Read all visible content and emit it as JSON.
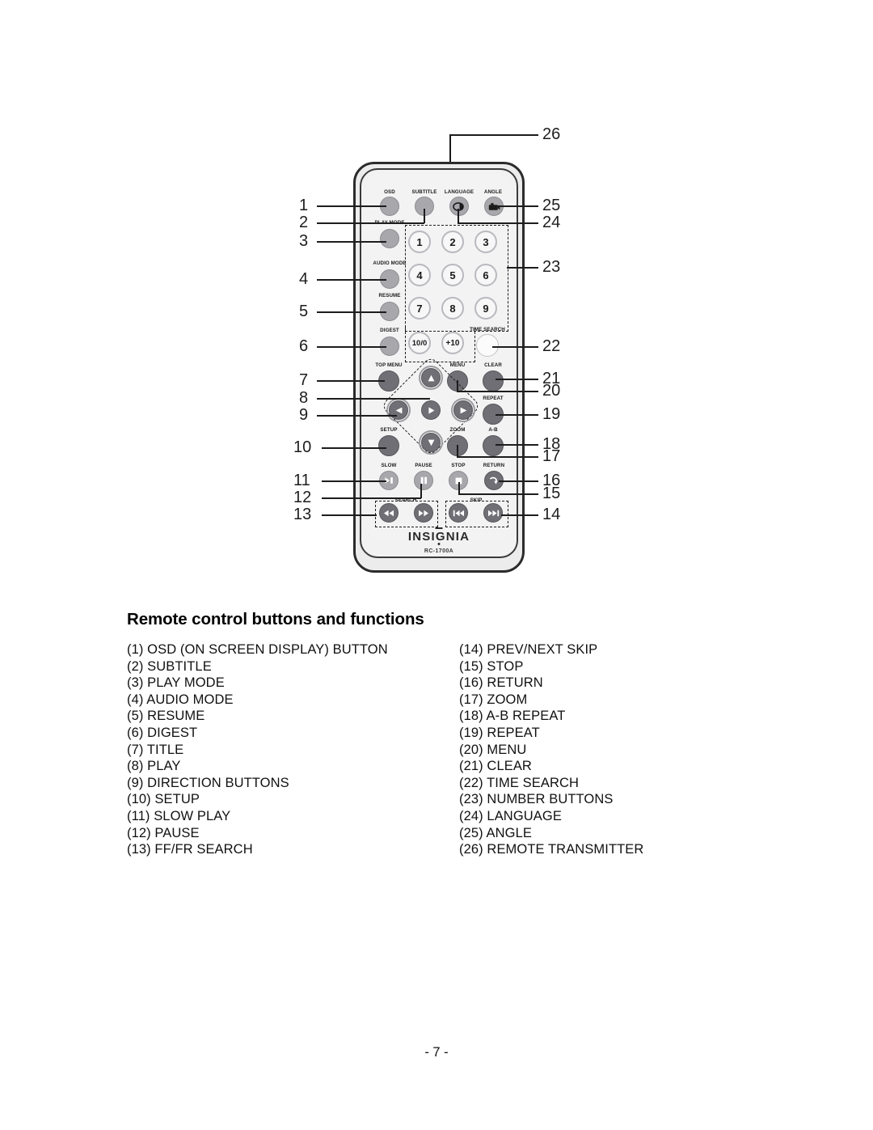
{
  "page": {
    "number_label": "- 7 -"
  },
  "section": {
    "title": "Remote control buttons and functions"
  },
  "figure": {
    "brand": "INSIGNIA",
    "model": "RC-1700A",
    "callouts_left": [
      "1",
      "2",
      "3",
      "4",
      "5",
      "6",
      "7",
      "8",
      "9",
      "10",
      "11",
      "12",
      "13"
    ],
    "callouts_right": [
      "26",
      "25",
      "24",
      "23",
      "22",
      "21",
      "20",
      "19",
      "18",
      "17",
      "16",
      "15",
      "14"
    ],
    "button_labels": {
      "osd": "OSD",
      "subtitle": "SUBTITLE",
      "language": "LANGUAGE",
      "angle": "ANGLE",
      "play_mode": "PLAY MODE",
      "audio_mode": "AUDIO MODE",
      "resume": "RESUME",
      "digest": "DIGEST",
      "top_menu": "TOP MENU",
      "menu": "MENU",
      "clear": "CLEAR",
      "time_search": "TIME SEARCH",
      "repeat": "REPEAT",
      "setup": "SETUP",
      "zoom": "ZOOM",
      "ab": "A-B",
      "slow": "SLOW",
      "pause": "PAUSE",
      "stop": "STOP",
      "return": "RETURN",
      "search": "SEARCH",
      "skip": "SKIP"
    },
    "number_keys": [
      "1",
      "2",
      "3",
      "4",
      "5",
      "6",
      "7",
      "8",
      "9",
      "10/0",
      "+10"
    ]
  },
  "functions": {
    "left": [
      "(1) OSD (ON SCREEN DISPLAY) BUTTON",
      "(2) SUBTITLE",
      "(3) PLAY MODE",
      "(4) AUDIO MODE",
      "(5) RESUME",
      "(6) DIGEST",
      "(7) TITLE",
      "(8) PLAY",
      "(9) DIRECTION BUTTONS",
      "(10) SETUP",
      "(11) SLOW PLAY",
      "(12) PAUSE",
      "(13) FF/FR SEARCH"
    ],
    "right": [
      "(14) PREV/NEXT SKIP",
      "(15) STOP",
      "(16) RETURN",
      "(17) ZOOM",
      "(18) A-B REPEAT",
      "(19) REPEAT",
      "(20) MENU",
      "(21) CLEAR",
      "(22) TIME SEARCH",
      "(23) NUMBER BUTTONS",
      "(24) LANGUAGE",
      "(25) ANGLE",
      "(26) REMOTE TRANSMITTER"
    ]
  }
}
